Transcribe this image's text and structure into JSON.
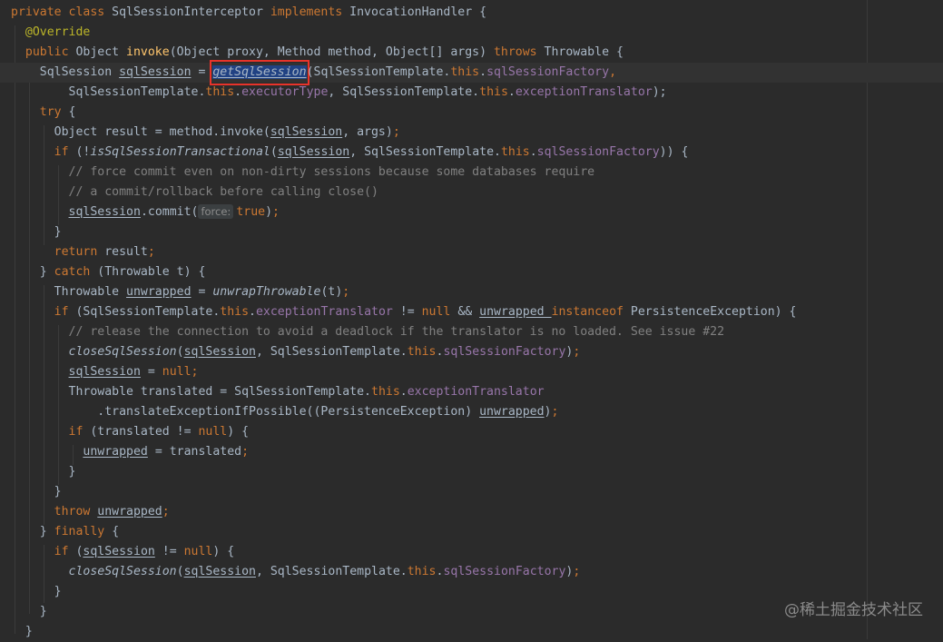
{
  "code": {
    "l1": {
      "a": "private class ",
      "b": "SqlSessionInterceptor ",
      "c": "implements ",
      "d": "InvocationHandler {"
    },
    "l2": {
      "a": "@Override"
    },
    "l3": {
      "a": "public ",
      "b": "Object ",
      "c": "invoke",
      "d": "(Object proxy, Method method, Object[] args) ",
      "e": "throws ",
      "f": "Throwable {"
    },
    "l4": {
      "a": "SqlSession ",
      "b": "sqlSession",
      "c": " = ",
      "d": "getSqlSession",
      "e": "(SqlSessionTemplate.",
      "f": "this",
      ".g": "",
      "g": ".",
      "h": "sqlSessionFactory",
      ",": ","
    },
    "l5": {
      "a": "SqlSessionTemplate.",
      "b": "this",
      "c": ".",
      "d": "executorType",
      "e": ", SqlSessionTemplate.",
      "f": "this",
      "g": ".",
      "h": "exceptionTranslator",
      "i": ");"
    },
    "l6": {
      "a": "try ",
      "b": "{"
    },
    "l7": {
      "a": "Object result = method.invoke(",
      "b": "sqlSession",
      "c": ", args)",
      "d": ";"
    },
    "l8": {
      "a": "if ",
      "b": "(!",
      "c": "isSqlSessionTransactional",
      "d": "(",
      "e": "sqlSession",
      "f": ", SqlSessionTemplate.",
      "g": "this",
      "h": ".",
      "i": "sqlSessionFactory",
      "j": ")) {"
    },
    "l9": {
      "a": "// force commit even on non-dirty sessions because some databases require"
    },
    "l10": {
      "a": "// a commit/rollback before calling close()"
    },
    "l11": {
      "a": "sqlSession",
      "b": ".commit(",
      "hint": "force:",
      "c": "true",
      "d": ")",
      "e": ";"
    },
    "l12": {
      "a": "}"
    },
    "l13": {
      "a": "return ",
      "b": "result",
      "c": ";"
    },
    "l14": {
      "a": "} ",
      "b": "catch ",
      "c": "(Throwable t) {"
    },
    "l15": {
      "a": "Throwable ",
      "b": "unwrapped",
      "c": " = ",
      "d": "unwrapThrowable",
      "e": "(t)",
      "f": ";"
    },
    "l16": {
      "a": "if ",
      "b": "(SqlSessionTemplate.",
      "c": "this",
      "d": ".",
      "e": "exceptionTranslator",
      "f": " != ",
      "g": "null ",
      "h": "&& ",
      "i": "unwrapped ",
      "j": "instanceof ",
      "k": "PersistenceException) {"
    },
    "l17": {
      "a": "// release the connection to avoid a deadlock if the translator is no loaded. See issue #22"
    },
    "l18": {
      "a": "closeSqlSession",
      "b": "(",
      "c": "sqlSession",
      "d": ", SqlSessionTemplate.",
      "e": "this",
      "f": ".",
      "g": "sqlSessionFactory",
      "h": ")",
      "i": ";"
    },
    "l19": {
      "a": "sqlSession",
      "b": " = ",
      "c": "null",
      "d": ";"
    },
    "l20": {
      "a": "Throwable translated = SqlSessionTemplate.",
      "b": "this",
      "c": ".",
      "d": "exceptionTranslator"
    },
    "l21": {
      "a": ".translateExceptionIfPossible((PersistenceException) ",
      "b": "unwrapped",
      "c": ")",
      "d": ";"
    },
    "l22": {
      "a": "if ",
      "b": "(translated != ",
      "c": "null",
      "d": ") {"
    },
    "l23": {
      "a": "unwrapped",
      "b": " = translated",
      "c": ";"
    },
    "l24": {
      "a": "}"
    },
    "l25": {
      "a": "}"
    },
    "l26": {
      "a": "throw ",
      "b": "unwrapped",
      "c": ";"
    },
    "l27": {
      "a": "} ",
      "b": "finally ",
      "c": "{"
    },
    "l28": {
      "a": "if ",
      "b": "(",
      "c": "sqlSession",
      "d": " != ",
      "e": "null",
      "f": ") {"
    },
    "l29": {
      "a": "closeSqlSession",
      "b": "(",
      "c": "sqlSession",
      "d": ", SqlSessionTemplate.",
      "e": "this",
      "f": ".",
      "g": "sqlSessionFactory",
      "h": ")",
      "i": ";"
    },
    "l30": {
      "a": "}"
    },
    "l31": {
      "a": "}"
    },
    "l32": {
      "a": "}"
    }
  },
  "watermark": "@稀土掘金技术社区",
  "colors": {
    "background": "#2b2b2b",
    "keyword": "#cc7832",
    "field": "#9876aa",
    "comment": "#808080",
    "highlight_box": "#e8332a"
  }
}
